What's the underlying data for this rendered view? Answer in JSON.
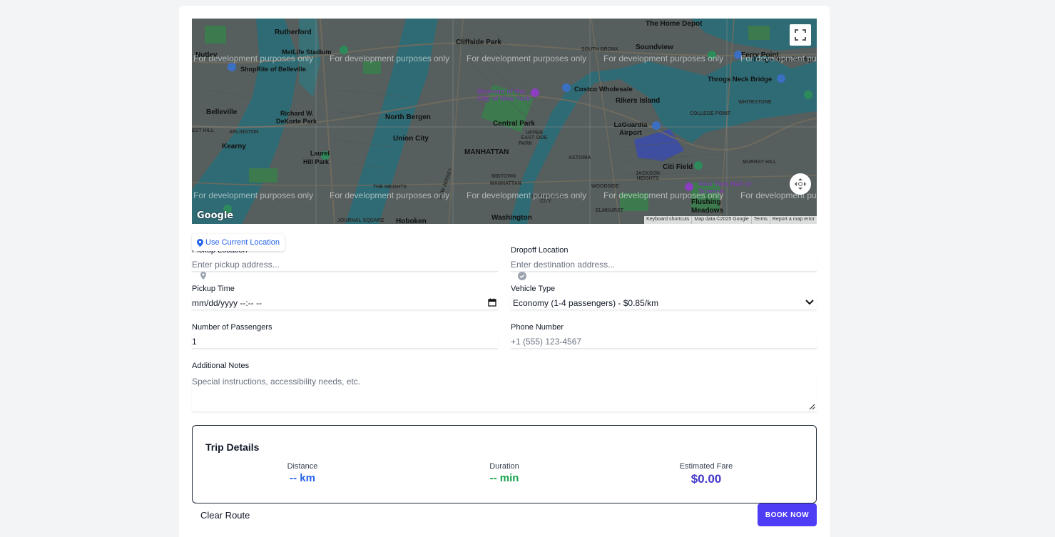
{
  "map": {
    "labels": {
      "rutherford": "Rutherford",
      "nutley": "Nutley",
      "metlife": "MetLife Stadium",
      "shoprite": "ShopRite of Belleville",
      "belleville": "Belleville",
      "richard_w": "Richard W.",
      "dekorte": "DeKorte Park",
      "arlington": "ARLINGTON",
      "east_hill": "EST HILL",
      "kearny": "Kearny",
      "laurel_hill": "Laurel",
      "laurel_hill2": "Hill Park",
      "north_bergen": "North Bergen",
      "union_city": "Union City",
      "the_heights": "THE HEIGHTS",
      "new_jersey": "NEW JERSEY",
      "hoboken": "Hoboken",
      "journal_square": "JOURNAL SQUARE",
      "cliffside_park": "Cliffside Park",
      "museum_city": "Museum of the City of New York",
      "central_park": "Central Park",
      "upper_east_side": "UPPER EAST SIDE",
      "manhattan": "MANHATTAN",
      "midtown": "MIDTOWN",
      "manhattan2": "MANHATTAN",
      "washington": "Washington",
      "the_home_depot": "The Home Depot",
      "south_bronx": "SOUTH BRONX",
      "soundview": "Soundview",
      "costco": "Costco Wholesale",
      "rikers_island": "Rikers Island",
      "laguardia": "LaGuardia Airport",
      "astoria": "ASTORIA",
      "long_island_city": "LONG ISLAND CITY",
      "woodside": "WOODSIDE",
      "jackson_heights": "JACKSON HEIGHTS",
      "citi_field": "Citi Field",
      "new_york_hall": "New York Hall of Science",
      "flushing": "Flushing",
      "flushing_meadows": "Meadows",
      "ferry_point": "Ferry Point",
      "throgs_neck_bridge": "Throgs Neck Bridge",
      "throgs_neck_bridge2": "Throgs Neck Bridge",
      "whitestone": "WHITESTONE",
      "college_point": "COLLEGE POINT",
      "murray_hill": "MURRAY HILL",
      "elmhurst": "ELMHURST",
      "park_label": "PARK"
    },
    "dev_watermark": "For development purposes only",
    "google_logo": "Google",
    "attribution": [
      "Keyboard shortcuts",
      "Map data ©2025 Google",
      "Terms",
      "Report a map error"
    ]
  },
  "form": {
    "use_current_location": "Use Current Location",
    "pickup": {
      "label": "Pickup Location",
      "placeholder": "Enter pickup address..."
    },
    "dropoff": {
      "label": "Dropoff Location",
      "placeholder": "Enter destination address..."
    },
    "pickup_time": {
      "label": "Pickup Time",
      "value": "mm/dd/yyyy --:-- --"
    },
    "vehicle_type": {
      "label": "Vehicle Type",
      "value": "Economy (1-4 passengers) - $0.85/km"
    },
    "passengers": {
      "label": "Number of Passengers",
      "value": "1"
    },
    "phone": {
      "label": "Phone Number",
      "placeholder": "+1 (555) 123-4567"
    },
    "notes": {
      "label": "Additional Notes",
      "placeholder": "Special instructions, accessibility needs, etc."
    }
  },
  "trip": {
    "title": "Trip Details",
    "distance": {
      "label": "Distance",
      "value": "-- km"
    },
    "duration": {
      "label": "Duration",
      "value": "-- min"
    },
    "fare": {
      "label": "Estimated Fare",
      "value": "$0.00"
    }
  },
  "actions": {
    "clear_route": "Clear Route",
    "book_now": "BOOK NOW"
  },
  "colors": {
    "accent": "#4f3cf5",
    "distance": "#2563eb",
    "duration": "#16a34a",
    "fare": "#4338ca"
  }
}
